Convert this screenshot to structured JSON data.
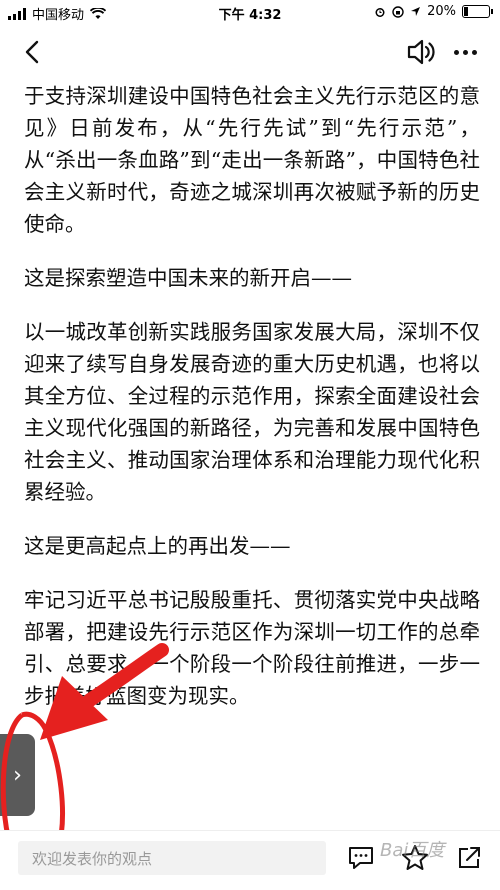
{
  "status_bar": {
    "carrier": "中国移动",
    "time": "下午 4:32",
    "battery_percent": "20%",
    "battery_level": 0.2
  },
  "article": {
    "paragraphs": [
      "于支持深圳建设中国特色社会主义先行示范区的意见》日前发布，从“先行先试”到“先行示范”，从“杀出一条血路”到“走出一条新路”，中国特色社会主义新时代，奇迹之城深圳再次被赋予新的历史使命。",
      "这是探索塑造中国未来的新开启——",
      "以一城改革创新实践服务国家发展大局，深圳不仅迎来了续写自身发展奇迹的重大历史机遇，也将以其全方位、全过程的示范作用，探索全面建设社会主义现代化强国的新路径，为完善和发展中国特色社会主义、推动国家治理体系和治理能力现代化积累经验。",
      "这是更高起点上的再出发——",
      "牢记习近平总书记殷殷重托、贯彻落实党中央战略部署，把建设先行示范区作为深圳一切工作的总牵引、总要求，一个阶段一个阶段往前推进，一步一步把美好蓝图变为现实。"
    ]
  },
  "side_tab": {
    "glyph": "›"
  },
  "bottom_bar": {
    "comment_placeholder": "欢迎发表你的观点"
  },
  "colors": {
    "annotation": "#e5211f",
    "side_tab": "#5a5a5a"
  }
}
